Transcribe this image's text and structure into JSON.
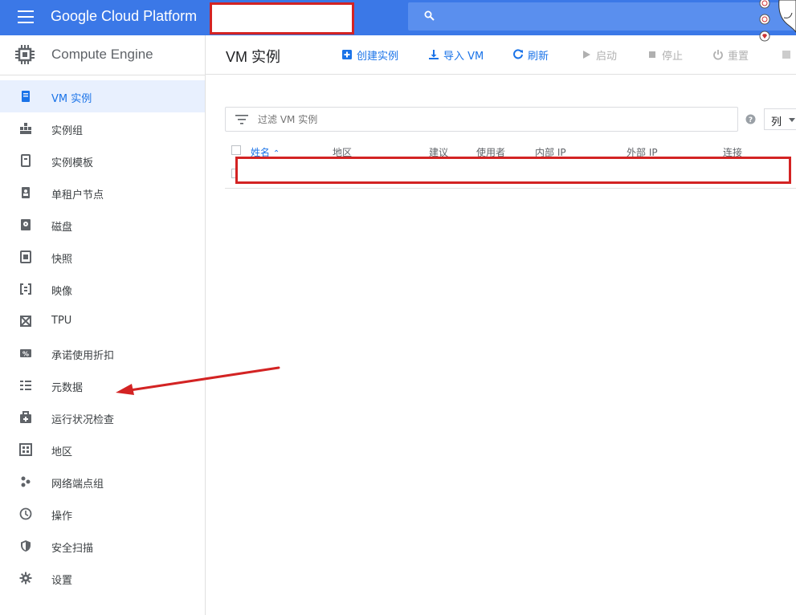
{
  "app": {
    "brand": "Google Cloud Platform",
    "product": "Compute Engine"
  },
  "toolbar": {
    "title": "VM 实例",
    "create": "创建实例",
    "import": "导入 VM",
    "refresh": "刷新",
    "start": "启动",
    "stop": "停止",
    "reset": "重置"
  },
  "sidebar": {
    "items": [
      {
        "label": "VM 实例",
        "icon": "vm-instance-icon",
        "active": true
      },
      {
        "label": "实例组",
        "icon": "instance-group-icon"
      },
      {
        "label": "实例模板",
        "icon": "instance-template-icon"
      },
      {
        "label": "单租户节点",
        "icon": "sole-tenant-icon"
      },
      {
        "label": "磁盘",
        "icon": "disk-icon"
      },
      {
        "label": "快照",
        "icon": "snapshot-icon"
      },
      {
        "label": "映像",
        "icon": "image-icon"
      },
      {
        "label": "TPU",
        "icon": "tpu-icon"
      },
      {
        "label": "承诺使用折扣",
        "icon": "discount-icon"
      },
      {
        "label": "元数据",
        "icon": "metadata-icon"
      },
      {
        "label": "运行状况检查",
        "icon": "health-check-icon"
      },
      {
        "label": "地区",
        "icon": "zones-icon"
      },
      {
        "label": "网络端点组",
        "icon": "network-endpoint-icon"
      },
      {
        "label": "操作",
        "icon": "operations-icon"
      },
      {
        "label": "安全扫描",
        "icon": "security-scan-icon"
      },
      {
        "label": "设置",
        "icon": "settings-icon"
      }
    ]
  },
  "filter": {
    "placeholder": "过滤 VM 实例",
    "columns_label": "列"
  },
  "table": {
    "columns": [
      "姓名",
      "地区",
      "建议",
      "使用者",
      "内部 IP",
      "外部 IP",
      "连接"
    ],
    "sorted_column": "姓名",
    "sort_direction": "ascending"
  },
  "colors": {
    "topbar": "#3b78e7",
    "accent": "#1a73e8",
    "annotation": "#d32323"
  }
}
